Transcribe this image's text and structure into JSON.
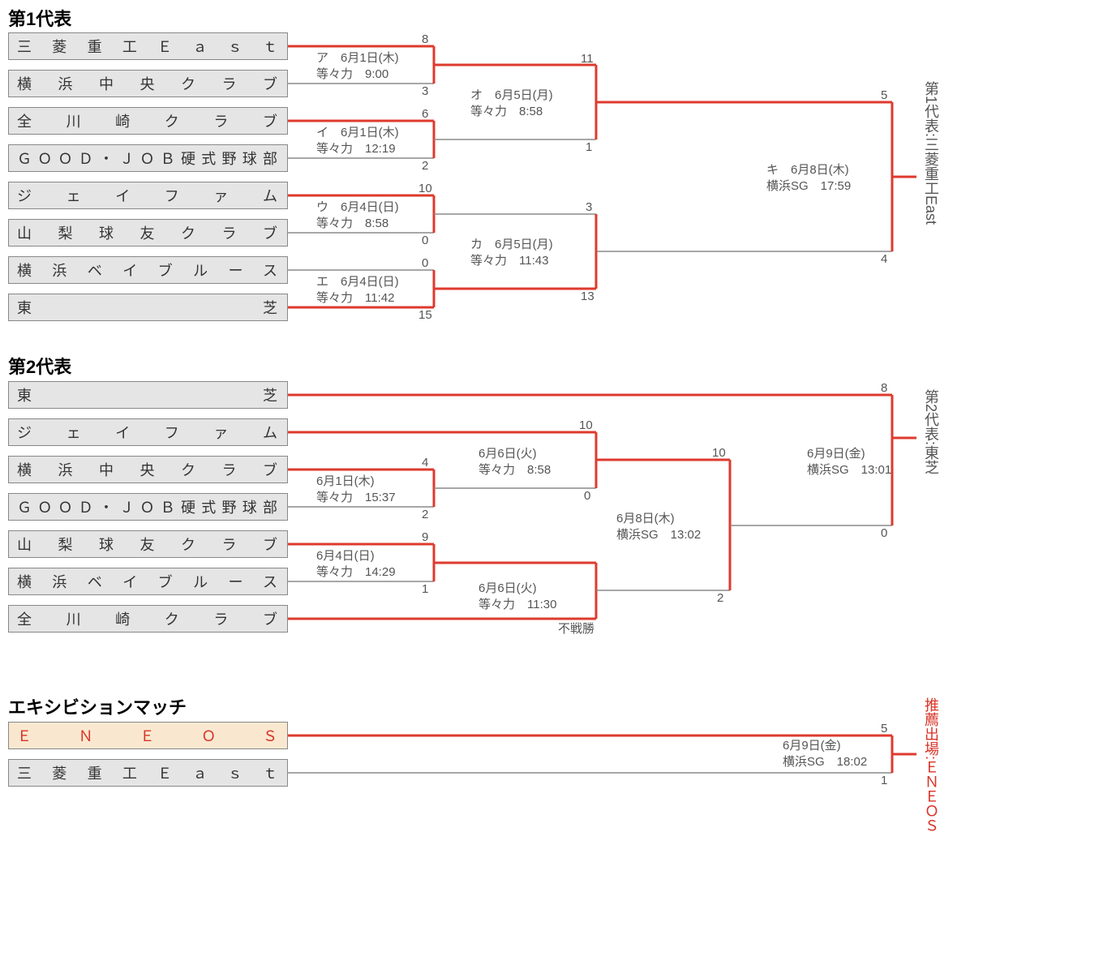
{
  "section1": {
    "title": "第1代表",
    "winner": "第1代表:三菱重工East"
  },
  "section2": {
    "title": "第2代表",
    "winner": "第2代表:東芝"
  },
  "section3": {
    "title": "エキシビションマッチ",
    "winner": "推薦出場:ＥＮＥＯＳ"
  },
  "teams1": [
    "三菱重工Ｅａｓｔ",
    "横浜中央クラブ",
    "全川崎クラブ",
    "ＧＯＯＤ・ＪＯＢ硬式野球部",
    "ジェイファム",
    "山梨球友クラブ",
    "横浜ベイブルース",
    "東芝"
  ],
  "teams2": [
    "東芝",
    "ジェイファム",
    "横浜中央クラブ",
    "ＧＯＯＤ・ＪＯＢ硬式野球部",
    "山梨球友クラブ",
    "横浜ベイブルース",
    "全川崎クラブ"
  ],
  "teams3": [
    "ＥＮＥＯＳ",
    "三菱重工Ｅａｓｔ"
  ],
  "m": {
    "a1": "ア　6月1日(木)\n等々力　9:00",
    "a2": "イ　6月1日(木)\n等々力　12:19",
    "a3": "ウ　6月4日(日)\n等々力　8:58",
    "a4": "エ　6月4日(日)\n等々力　11:42",
    "a5": "オ　6月5日(月)\n等々力　8:58",
    "a6": "カ　6月5日(月)\n等々力　11:43",
    "a7": "キ　6月8日(木)\n横浜SG　17:59",
    "b1": "6月1日(木)\n等々力　15:37",
    "b2": "6月4日(日)\n等々力　14:29",
    "b3": "6月6日(火)\n等々力　8:58",
    "b4": "6月6日(火)\n等々力　11:30",
    "b5": "6月8日(木)\n横浜SG　13:02",
    "b6": "6月9日(金)\n横浜SG　13:01",
    "c1": "6月9日(金)\n横浜SG　18:02",
    "walkover": "不戦勝"
  },
  "s": {
    "a1t": "8",
    "a1b": "3",
    "a2t": "6",
    "a2b": "2",
    "a3t": "10",
    "a3b": "0",
    "a4t": "0",
    "a4b": "15",
    "a5t": "11",
    "a5b": "1",
    "a6t": "3",
    "a6b": "13",
    "a7t": "5",
    "a7b": "4",
    "b1t": "4",
    "b1b": "2",
    "b2t": "9",
    "b2b": "1",
    "b3t": "10",
    "b3b": "0",
    "b5t": "10",
    "b5b": "2",
    "b6t": "8",
    "b6b": "0",
    "c1t": "5",
    "c1b": "1"
  }
}
